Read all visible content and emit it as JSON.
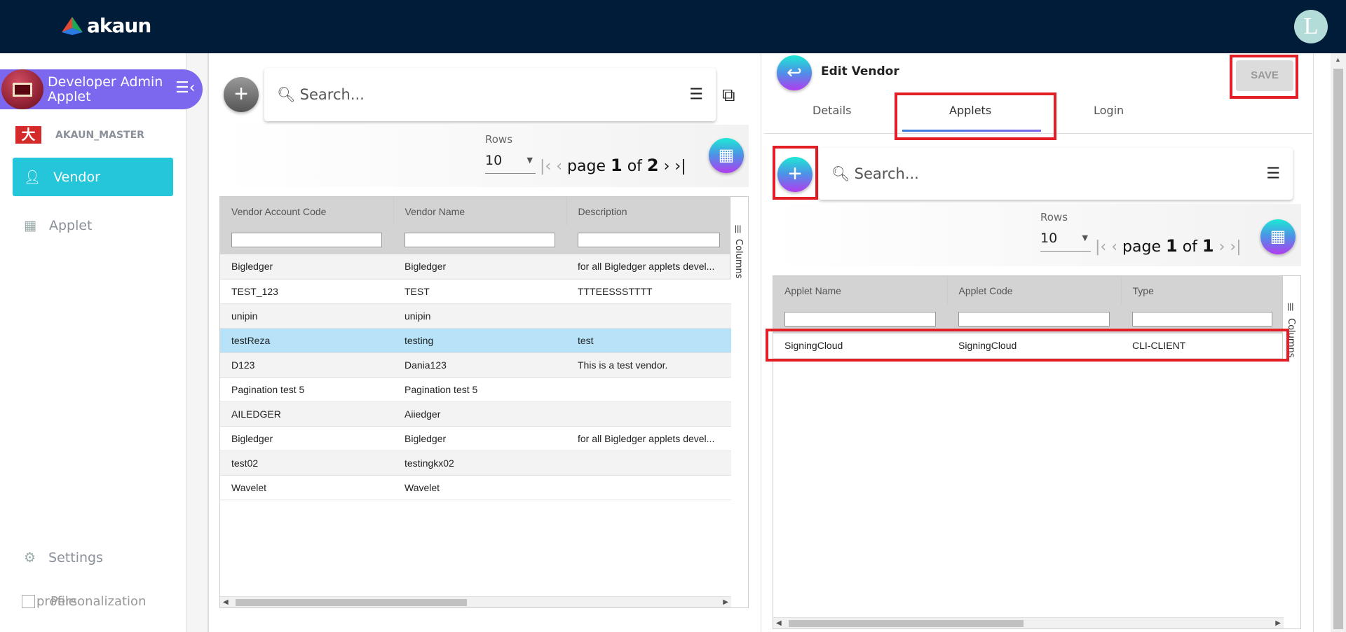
{
  "header": {
    "brand": "akaun",
    "avatar_letter": "L"
  },
  "sidebar": {
    "applet_title": "Developer Admin Applet",
    "org": "AKAUN_MASTER",
    "items": [
      {
        "label": "Vendor",
        "active": true
      },
      {
        "label": "Applet"
      }
    ],
    "settings": "Settings",
    "personalization": "Personalization",
    "profile_overlap": "profile"
  },
  "vendor_list": {
    "search_placeholder": "Search...",
    "rows_label": "Rows",
    "rows_value": "10",
    "page_word": "page",
    "page": "1",
    "of_word": "of",
    "total_pages": "2",
    "columns_label": "Columns",
    "headers": [
      "Vendor Account Code",
      "Vendor Name",
      "Description"
    ],
    "rows": [
      [
        "Bigledger",
        "Bigledger",
        "for all Bigledger applets devel..."
      ],
      [
        "TEST_123",
        "TEST",
        "TTTEESSSTTTT"
      ],
      [
        "unipin",
        "unipin",
        ""
      ],
      [
        "testReza",
        "testing",
        "test"
      ],
      [
        "D123",
        "Dania123",
        "This is a test vendor."
      ],
      [
        "Pagination test 5",
        "Pagination test 5",
        ""
      ],
      [
        "AILEDGER",
        "Aiiedger",
        ""
      ],
      [
        "Bigledger",
        "Bigledger",
        "for all Bigledger applets devel..."
      ],
      [
        "test02",
        "testingkx02",
        ""
      ],
      [
        "Wavelet",
        "Wavelet",
        ""
      ]
    ],
    "selected_row": 3
  },
  "edit_vendor": {
    "title": "Edit Vendor",
    "save_label": "SAVE",
    "tabs": [
      "Details",
      "Applets",
      "Login"
    ],
    "active_tab": 1,
    "search_placeholder": "Search...",
    "rows_label": "Rows",
    "rows_value": "10",
    "page_word": "page",
    "page": "1",
    "of_word": "of",
    "total_pages": "1",
    "columns_label": "Columns",
    "headers": [
      "Applet Name",
      "Applet Code",
      "Type"
    ],
    "rows": [
      [
        "SigningCloud",
        "SigningCloud",
        "CLI-CLIENT"
      ]
    ]
  },
  "colors": {
    "header_bg": "#011c38",
    "accent_purple": "#7b68ee",
    "active_item": "#26c6da",
    "highlight": "#e21e26",
    "selected_row": "#b7e2f8"
  }
}
